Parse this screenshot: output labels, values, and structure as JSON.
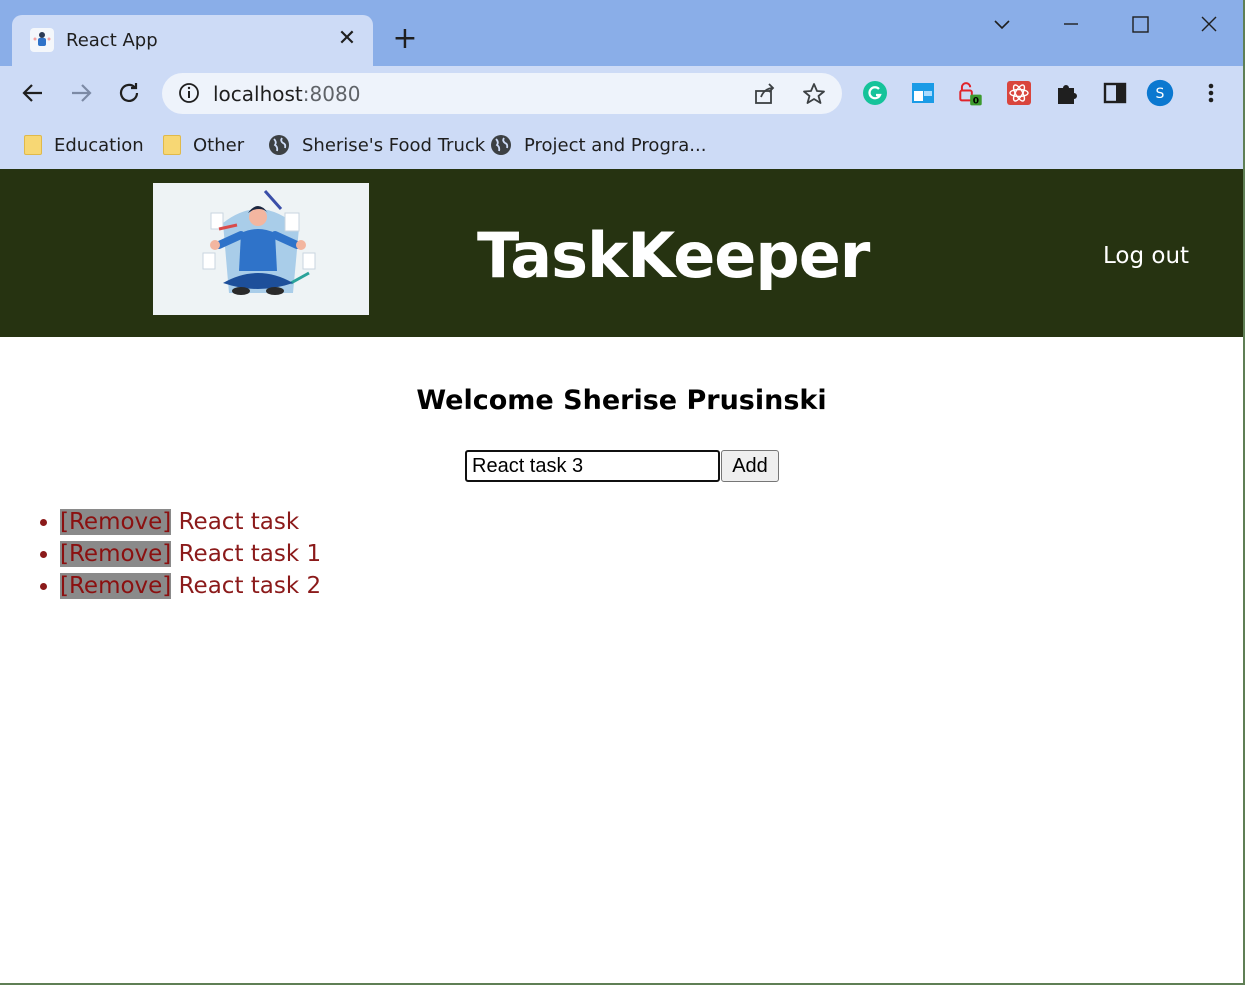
{
  "browser": {
    "tab": {
      "title": "React App",
      "favicon": "react-app-favicon",
      "close_glyph": "✕"
    },
    "new_tab_glyph": "+",
    "window_controls": {
      "tab_search": "chevron-down-icon",
      "minimize": "minimize-icon",
      "maximize": "maximize-icon",
      "close": "close-icon"
    },
    "toolbar": {
      "back": "back-arrow-icon",
      "forward": "forward-arrow-icon",
      "reload": "reload-icon",
      "url_host": "localhost",
      "url_port": ":8080",
      "share": "share-icon",
      "bookmark": "star-icon"
    },
    "extensions": [
      {
        "name": "grammarly-icon",
        "color": "#15c39a"
      },
      {
        "name": "window-extension-icon",
        "color": "#1a9be6"
      },
      {
        "name": "lock-extension-icon",
        "color": "#e0232b",
        "badge": "0"
      },
      {
        "name": "react-devtools-icon",
        "color": "#d9453d"
      },
      {
        "name": "puzzle-icon"
      },
      {
        "name": "side-panel-icon"
      },
      {
        "name": "profile-avatar",
        "letter": "S",
        "color": "#0b78d0"
      },
      {
        "name": "more-menu-icon"
      }
    ],
    "bookmarks": [
      {
        "label": "Education",
        "icon": "folder-icon"
      },
      {
        "label": "Other",
        "icon": "folder-icon"
      },
      {
        "label": "Sherise's Food Truck",
        "icon": "globe-icon"
      },
      {
        "label": "Project and Progra...",
        "icon": "globe-icon"
      }
    ]
  },
  "app": {
    "header_bg": "#263311",
    "brand": "TaskKeeper",
    "logout_label": "Log out",
    "welcome": "Welcome Sherise Prusinski",
    "task_input": {
      "value": "React task 3"
    },
    "add_label": "Add",
    "tasks": [
      {
        "remove_label": "[Remove]",
        "text": "React task"
      },
      {
        "remove_label": "[Remove]",
        "text": "React task 1"
      },
      {
        "remove_label": "[Remove]",
        "text": "React task 2"
      }
    ]
  }
}
